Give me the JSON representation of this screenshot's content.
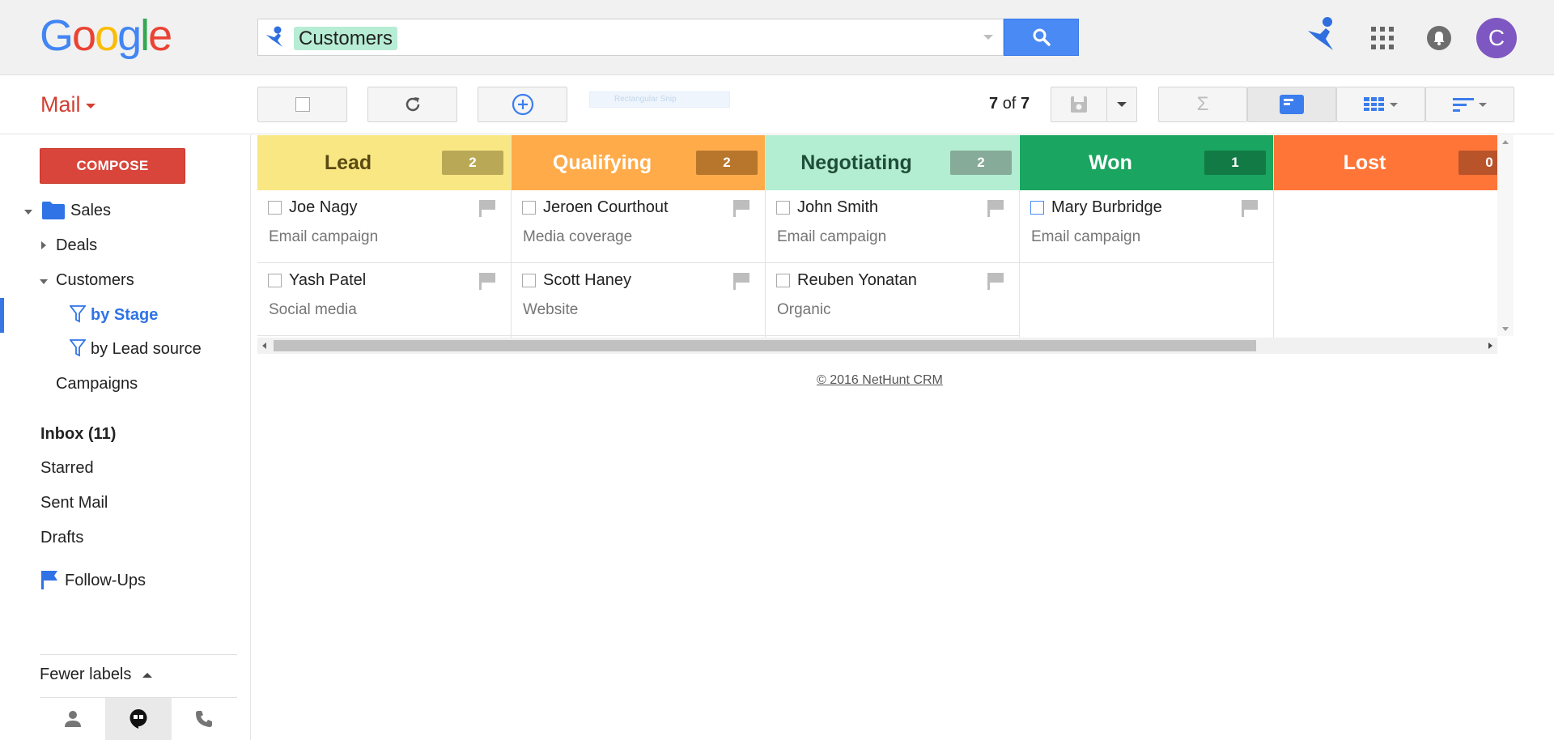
{
  "logo": {
    "letters": [
      "G",
      "o",
      "o",
      "g",
      "l",
      "e"
    ],
    "colors": [
      "#4285f4",
      "#ea4335",
      "#fbbc05",
      "#4285f4",
      "#34a853",
      "#ea4335"
    ]
  },
  "search": {
    "chip": "Customers",
    "button_icon": "search-icon"
  },
  "header": {
    "avatar_letter": "C"
  },
  "toolbar": {
    "mail_label": "Mail",
    "ghost_text": "Rectangular Snip",
    "pager_current": "7",
    "pager_of": "of",
    "pager_total": "7"
  },
  "sidebar": {
    "compose": "COMPOSE",
    "sales": "Sales",
    "deals": "Deals",
    "customers": "Customers",
    "by_stage": "by Stage",
    "by_lead_source": "by Lead source",
    "campaigns": "Campaigns",
    "inbox": "Inbox (11)",
    "starred": "Starred",
    "sent": "Sent Mail",
    "drafts": "Drafts",
    "followups": "Follow-Ups",
    "fewer_labels": "Fewer labels"
  },
  "board": {
    "columns": [
      {
        "title": "Lead",
        "count": "2",
        "bg": "#f9e784",
        "title_color": "#5a4a12",
        "badge_bg": "#b9a956",
        "cards": [
          {
            "name": "Joe Nagy",
            "sub": "Email campaign"
          },
          {
            "name": "Yash Patel",
            "sub": "Social media"
          }
        ]
      },
      {
        "title": "Qualifying",
        "count": "2",
        "bg": "#ffab4a",
        "title_color": "#ffffff",
        "badge_bg": "#b8762c",
        "cards": [
          {
            "name": "Jeroen Courthout",
            "sub": "Media coverage"
          },
          {
            "name": "Scott Haney",
            "sub": "Website"
          }
        ]
      },
      {
        "title": "Negotiating",
        "count": "2",
        "bg": "#b3edd2",
        "title_color": "#1f4d38",
        "badge_bg": "#86ab98",
        "cards": [
          {
            "name": "John Smith",
            "sub": "Email campaign"
          },
          {
            "name": "Reuben Yonatan",
            "sub": "Organic"
          }
        ]
      },
      {
        "title": "Won",
        "count": "1",
        "bg": "#1aa560",
        "title_color": "#ffffff",
        "badge_bg": "#127a45",
        "cards": [
          {
            "name": "Mary Burbridge",
            "sub": "Email campaign"
          }
        ]
      },
      {
        "title": "Lost",
        "count": "0",
        "bg": "#ff7537",
        "title_color": "#ffffff",
        "badge_bg": "#b9532a",
        "cards": []
      }
    ]
  },
  "footer": "© 2016 NetHunt CRM"
}
